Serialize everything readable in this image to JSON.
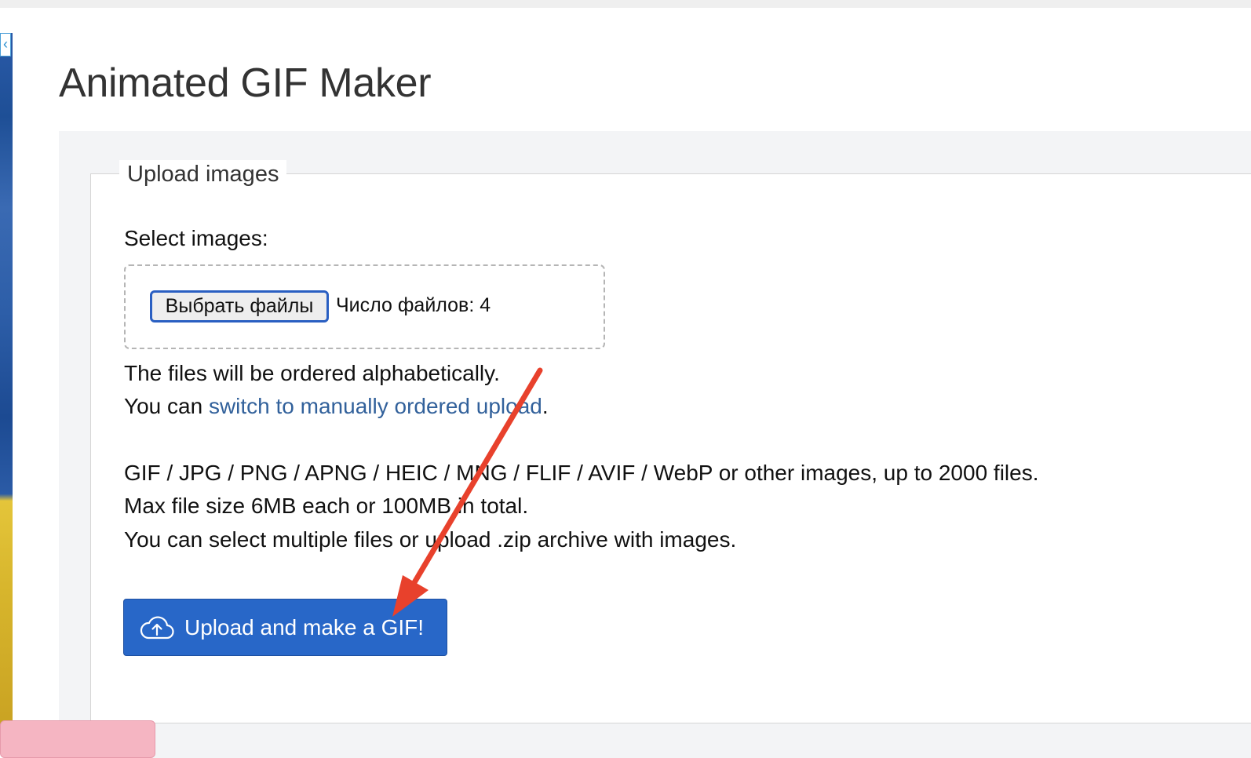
{
  "page": {
    "title": "Animated GIF Maker"
  },
  "upload_form": {
    "legend": "Upload images",
    "select_label": "Select images:",
    "file_button_label": "Выбрать файлы",
    "file_count_text": "Число файлов: 4",
    "order_note": "The files will be ordered alphabetically.",
    "switch_prefix": "You can ",
    "switch_link": "switch to manually ordered upload",
    "switch_suffix": ".",
    "formats_line": "GIF / JPG / PNG / APNG / HEIC / MNG / FLIF / AVIF / WebP or other images, up to 2000 files.",
    "size_line": "Max file size 6MB each or 100MB in total.",
    "zip_line": "You can select multiple files or upload .zip archive with images.",
    "submit_label": "Upload and make a GIF!"
  },
  "icons": {
    "upload": "cloud-upload-icon",
    "side_close": "chevron-left-icon"
  },
  "colors": {
    "primary_button": "#2867c8",
    "link": "#32619b",
    "annotation_arrow": "#e8412c",
    "panel_bg": "#f3f4f6"
  }
}
